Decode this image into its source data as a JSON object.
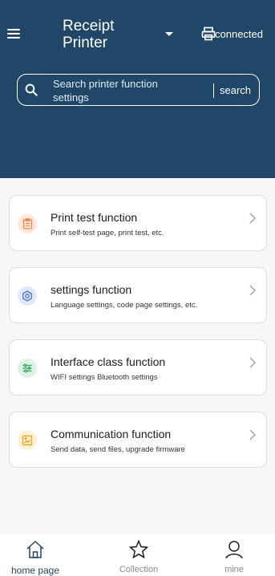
{
  "header": {
    "title": "Receipt Printer",
    "status": "connected"
  },
  "search": {
    "placeholder": "Search printer function settings",
    "button": "search"
  },
  "cards": [
    {
      "title": "Print test function",
      "desc": "Print self-test page, print test, etc.",
      "icon": "clipboard-icon",
      "color": "#f2874e",
      "bg": "#fde8dc"
    },
    {
      "title": "settings function",
      "desc": "Language settings, code page settings, etc.",
      "icon": "gear-icon",
      "color": "#4a6ed8",
      "bg": "#e0e8fb"
    },
    {
      "title": "Interface class function",
      "desc": "WIFI settings Bluetooth settings",
      "icon": "sliders-icon",
      "color": "#3ba55d",
      "bg": "#dcf3e3"
    },
    {
      "title": "Communication function",
      "desc": "Send data, send files, upgrade firmware",
      "icon": "image-icon",
      "color": "#f0a21d",
      "bg": "#fdf0d2"
    }
  ],
  "tabs": [
    {
      "label": "home page",
      "icon": "home-icon",
      "active": true
    },
    {
      "label": "Collection",
      "icon": "star-icon",
      "active": false
    },
    {
      "label": "mine",
      "icon": "person-icon",
      "active": false
    }
  ],
  "colors": {
    "header_bg": "#204767",
    "active_tab": "#204767"
  }
}
